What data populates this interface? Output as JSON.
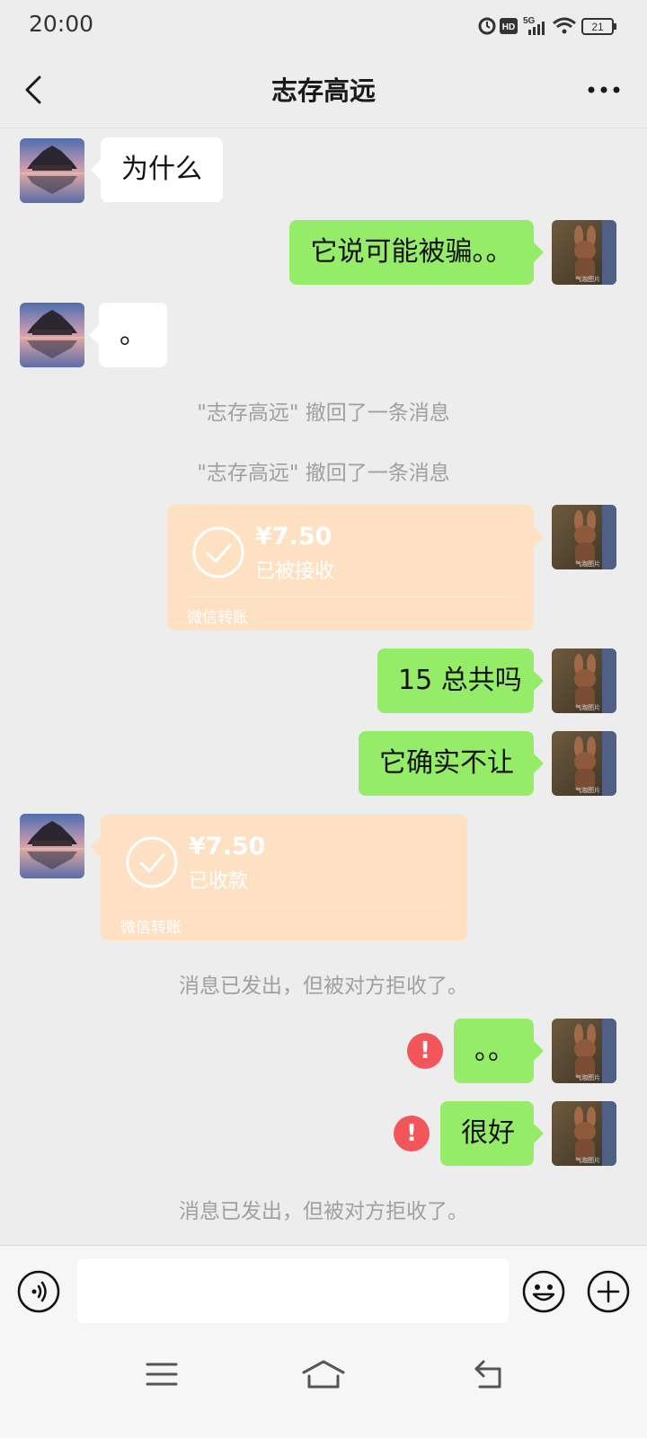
{
  "status": {
    "time": "20:00",
    "battery": "21",
    "network": "5G"
  },
  "header": {
    "title": "志存高远"
  },
  "messages": [
    {
      "text": "为什么"
    },
    {
      "text": "它说可能被骗。。"
    },
    {
      "text": "。"
    },
    {
      "text": "\"志存高远\" 撤回了一条消息"
    },
    {
      "text": "\"志存高远\" 撤回了一条消息"
    },
    {
      "amount": "¥7.50",
      "state": "已被接收",
      "brand": "微信转账"
    },
    {
      "text": "15 总共吗"
    },
    {
      "text": "它确实不让"
    },
    {
      "amount": "¥7.50",
      "state": "已收款",
      "brand": "微信转账"
    },
    {
      "text": "消息已发出，但被对方拒收了。"
    },
    {
      "text": "。。"
    },
    {
      "text": "很好"
    },
    {
      "text": "消息已发出，但被对方拒收了。"
    }
  ],
  "fail_icon": "!",
  "avatars": {
    "self_caption": "气泡图片"
  },
  "colors": {
    "background": "#ededed",
    "outgoing_bubble": "#95ec69",
    "incoming_bubble": "#ffffff",
    "transfer_bubble": "#fde1c2",
    "error": "#f2565a"
  },
  "icons": {
    "back": "chevron-left-icon",
    "more": "more-dots-icon",
    "voice": "voice-icon",
    "emoji": "emoji-icon",
    "plus": "plus-icon",
    "check": "check-circle-icon",
    "menu": "menu-icon",
    "home": "home-icon",
    "return": "return-icon"
  }
}
